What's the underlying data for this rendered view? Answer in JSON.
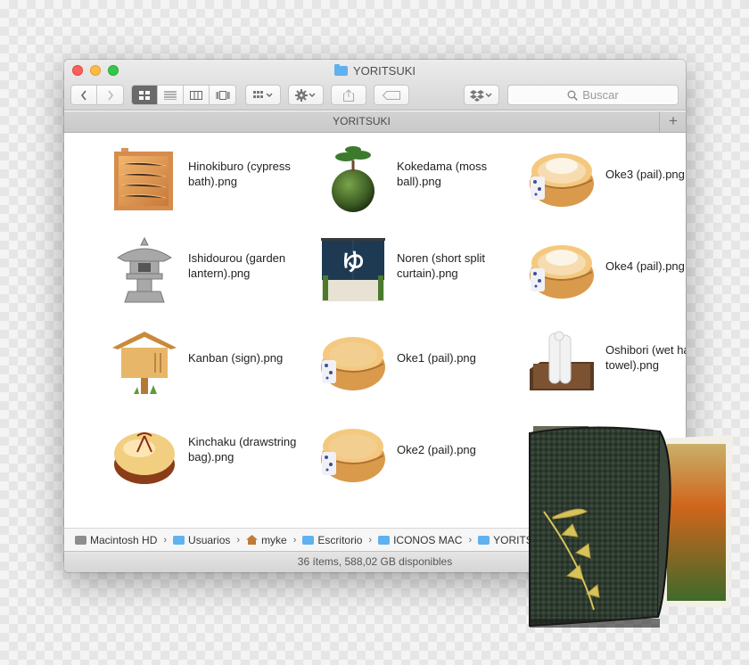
{
  "window": {
    "title": "YORITSUKI",
    "tab_title": "YORITSUKI",
    "add_tab_label": "+",
    "search_placeholder": "Buscar"
  },
  "toolbar": {
    "back_icon": "chevron-left-icon",
    "forward_icon": "chevron-right-icon",
    "views": [
      "icon-view",
      "list-view",
      "column-view",
      "cover-flow-view"
    ],
    "active_view": "icon-view"
  },
  "files": [
    {
      "name": "Hinokiburo (cypress bath).png",
      "icon": "wooden-bath-icon"
    },
    {
      "name": "Kokedama (moss ball).png",
      "icon": "moss-ball-icon"
    },
    {
      "name": "Oke3 (pail).png",
      "icon": "steaming-pail-icon"
    },
    {
      "name": "Ishidourou (garden lantern).png",
      "icon": "stone-lantern-icon"
    },
    {
      "name": "Noren (short split curtain).png",
      "icon": "noren-curtain-icon"
    },
    {
      "name": "Oke4 (pail).png",
      "icon": "steaming-pail-icon"
    },
    {
      "name": "Kanban (sign).png",
      "icon": "wooden-sign-icon"
    },
    {
      "name": "Oke1 (pail).png",
      "icon": "wooden-pail-icon"
    },
    {
      "name": "Oshibori (wet hand towel).png",
      "icon": "rolled-towels-icon"
    },
    {
      "name": "Kinchaku (drawstring bag).png",
      "icon": "drawstring-bag-icon"
    },
    {
      "name": "Oke2 (pail).png",
      "icon": "wooden-pail-icon"
    }
  ],
  "path": [
    {
      "label": "Macintosh HD",
      "icon": "hard-disk-icon"
    },
    {
      "label": "Usuarios",
      "icon": "folder-icon"
    },
    {
      "label": "myke",
      "icon": "home-icon"
    },
    {
      "label": "Escritorio",
      "icon": "folder-icon"
    },
    {
      "label": "ICONOS MAC",
      "icon": "folder-icon"
    },
    {
      "label": "YORITSUKI",
      "icon": "folder-icon"
    }
  ],
  "status": "36 ítems, 588,02 GB disponibles",
  "colors": {
    "folder_blue": "#5fb1ef",
    "close": "#fc605b",
    "minimize": "#fdbc40",
    "zoom": "#34c84a"
  }
}
